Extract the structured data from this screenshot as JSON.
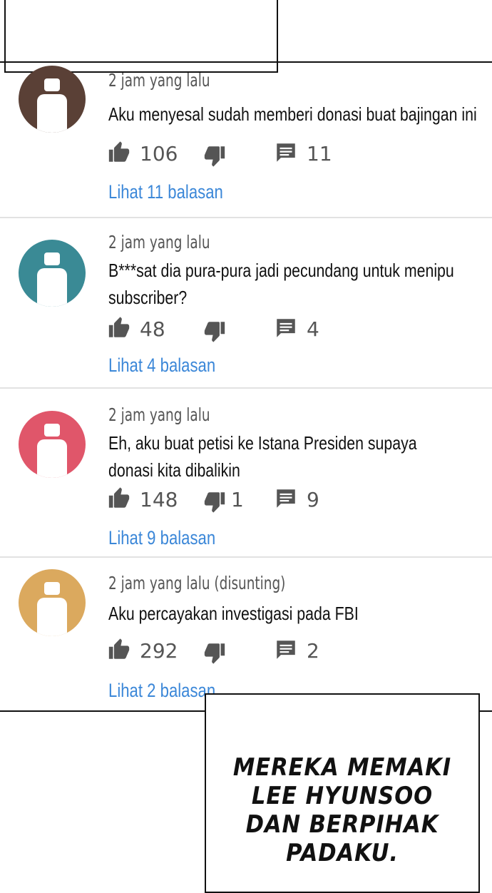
{
  "comments": [
    {
      "time": "2 jam yang lalu",
      "text": [
        "Aku menyesal sudah memberi donasi buat bajingan ini"
      ],
      "likes": "106",
      "dislikes": "",
      "replies": "11",
      "view_replies": "Lihat 11 balasan",
      "avatar_color": "#5a4036"
    },
    {
      "time": "2 jam yang lalu",
      "text": [
        "B***sat dia pura-pura jadi pecundang untuk menipu",
        "subscriber?"
      ],
      "likes": "48",
      "dislikes": "",
      "replies": "4",
      "view_replies": "Lihat 4 balasan",
      "avatar_color": "#3a8a95"
    },
    {
      "time": "2 jam yang lalu",
      "text": [
        "Eh, aku buat petisi ke Istana Presiden supaya",
        "donasi kita dibalikin"
      ],
      "likes": "148",
      "dislikes": "1",
      "replies": "9",
      "view_replies": "Lihat 9 balasan",
      "avatar_color": "#e0566a"
    },
    {
      "time": "2 jam yang lalu (disunting)",
      "text": [
        "Aku percayakan investigasi pada FBI"
      ],
      "likes": "292",
      "dislikes": "",
      "replies": "2",
      "view_replies": "Lihat 2 balasan",
      "avatar_color": "#dba95e"
    }
  ],
  "icons": {
    "like": "thumbs-up-icon",
    "dislike": "thumbs-down-icon",
    "reply": "comment-icon"
  },
  "colors": {
    "link": "#3b87d8",
    "icon": "#555555"
  },
  "narration": [
    "MEREKA MEMAKI",
    "LEE HYUNSOO",
    "DAN BERPIHAK",
    "PADAKU."
  ]
}
